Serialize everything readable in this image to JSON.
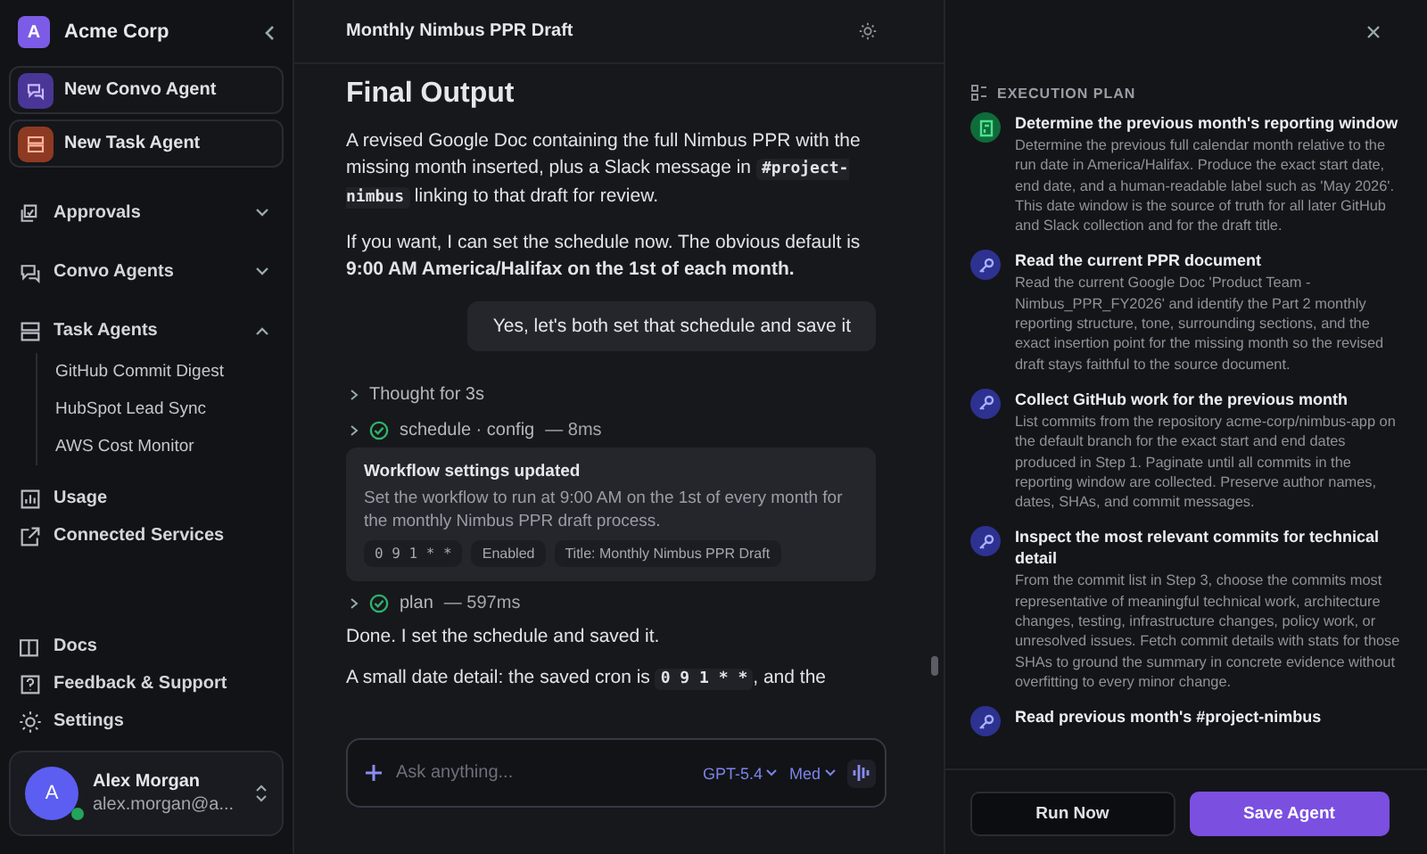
{
  "sidebar": {
    "org": {
      "initial": "A",
      "name": "Acme Corp"
    },
    "actions": [
      {
        "kind": "convo",
        "label": "New Convo Agent"
      },
      {
        "kind": "task",
        "label": "New Task Agent"
      }
    ],
    "nav": [
      {
        "label": "Approvals",
        "expanded": false
      },
      {
        "label": "Convo Agents",
        "expanded": false
      },
      {
        "label": "Task Agents",
        "expanded": true,
        "children": [
          {
            "label": "GitHub Commit Digest"
          },
          {
            "label": "HubSpot Lead Sync"
          },
          {
            "label": "AWS Cost Monitor"
          }
        ]
      }
    ],
    "links": [
      {
        "label": "Usage"
      },
      {
        "label": "Connected Services"
      }
    ],
    "footer_links": [
      {
        "label": "Docs"
      },
      {
        "label": "Feedback & Support"
      },
      {
        "label": "Settings"
      }
    ],
    "user": {
      "initial": "A",
      "name": "Alex Morgan",
      "email": "alex.morgan@a...",
      "online": true
    }
  },
  "main": {
    "title": "Monthly Nimbus PPR Draft",
    "heading": "Final Output",
    "paragraphs": [
      "A revised Google Doc containing the full Nimbus PPR with the missing month inserted, plus a Slack message in ",
      "If you want, I can set the schedule now. The obvious default is **9:00 AM America/Halifax on the 1st of each month.**"
    ],
    "code_channel": "#project-nimbus",
    "after_code": " linking to that draft for review.",
    "user_message": "Yes, let's both set that schedule and save it",
    "thought": "Thought for 3s",
    "tools": [
      {
        "name": "schedule · config",
        "time": "— 8ms",
        "done": true,
        "card": {
          "title": "Workflow settings updated",
          "body": "Set the workflow to run at 9:00 AM on the 1st of every month for the monthly Nimbus PPR draft process.",
          "chips": [
            {
              "kind": "code",
              "text": "0 9 1 * *"
            },
            {
              "kind": "text",
              "text": "Enabled"
            },
            {
              "kind": "text",
              "text": "Title: Monthly Nimbus PPR Draft"
            }
          ]
        }
      },
      {
        "name": "plan",
        "time": "— 597ms",
        "done": true
      }
    ],
    "reply": "Done. I set the schedule and saved it.",
    "reply2_before": "A small date detail: the saved cron is ",
    "reply2_code": "0 9 1 * *",
    "reply2_after": ", and the",
    "composer": {
      "placeholder": "Ask anything...",
      "model": "GPT-5.4",
      "effort": "Med"
    }
  },
  "plan": {
    "heading": "EXECUTION PLAN",
    "steps": [
      {
        "kind": "sheet",
        "title": "Determine the previous month's reporting window",
        "body": "Determine the previous full calendar month relative to the run date in America/Halifax. Produce the exact start date, end date, and a human-readable label such as 'May 2026'. This date window is the source of truth for all later GitHub and Slack collection and for the draft title."
      },
      {
        "kind": "tool",
        "title": "Read the current PPR document",
        "body": "Read the current Google Doc 'Product Team - Nimbus_PPR_FY2026' and identify the Part 2 monthly reporting structure, tone, surrounding sections, and the exact insertion point for the missing month so the revised draft stays faithful to the source document."
      },
      {
        "kind": "tool",
        "title": "Collect GitHub work for the previous month",
        "body": "List commits from the repository acme-corp/nimbus-app on the default branch for the exact start and end dates produced in Step 1. Paginate until all commits in the reporting window are collected. Preserve author names, dates, SHAs, and commit messages."
      },
      {
        "kind": "tool",
        "title": "Inspect the most relevant commits for technical detail",
        "body": "From the commit list in Step 3, choose the commits most representative of meaningful technical work, architecture changes, testing, infrastructure changes, policy work, or unresolved issues. Fetch commit details with stats for those SHAs to ground the summary in concrete evidence without overfitting to every minor change."
      },
      {
        "kind": "tool",
        "title": "Read previous month's #project-nimbus"
      }
    ],
    "buttons": [
      {
        "kind": "secondary",
        "label": "Run Now"
      },
      {
        "kind": "primary",
        "label": "Save Agent"
      }
    ]
  }
}
